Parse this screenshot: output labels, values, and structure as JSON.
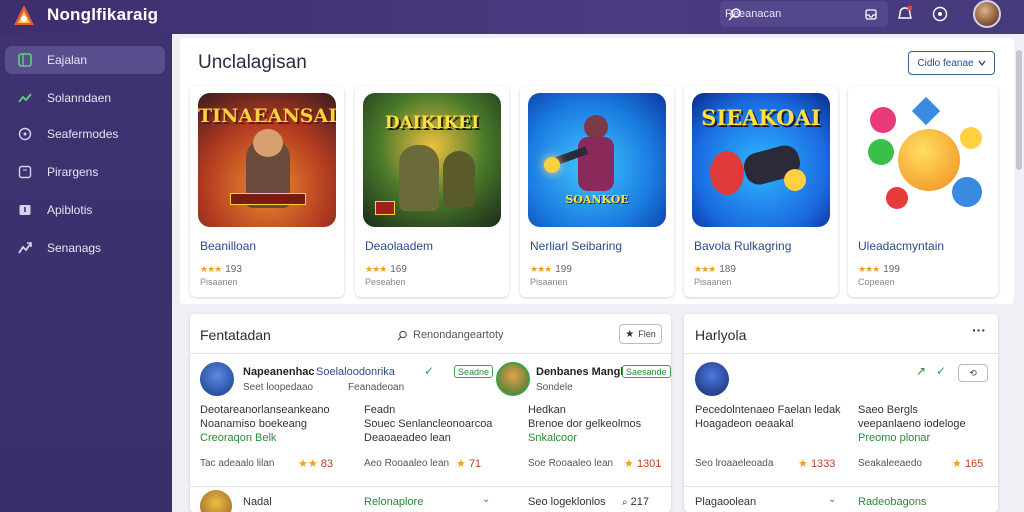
{
  "app": {
    "title": "Nonglfikaraig"
  },
  "search": {
    "placeholder": "Reeanacan"
  },
  "sidebar": {
    "items": [
      {
        "label": "Eajalan",
        "icon": "grid-icon",
        "active": true
      },
      {
        "label": "Solanndaen",
        "icon": "trend-icon",
        "active": false
      },
      {
        "label": "Seafermodes",
        "icon": "compass-icon",
        "active": false
      },
      {
        "label": "Pirargens",
        "icon": "square-icon",
        "active": false
      },
      {
        "label": "Apiblotis",
        "icon": "download-icon",
        "active": false
      },
      {
        "label": "Senanags",
        "icon": "share-icon",
        "active": false
      }
    ]
  },
  "featured": {
    "title": "Unclalagisan",
    "button": "Cidlo feanae",
    "cards": [
      {
        "art_title": "TINAEANSAI",
        "name": "Beanilloan",
        "stars": "★★★",
        "rating": "193",
        "sub": "Pisaanen"
      },
      {
        "art_title": "DAIKIKEI",
        "name": "Deaolaadem",
        "stars": "★★★",
        "rating": "169",
        "sub": "Peseahen"
      },
      {
        "art_title": "SOANKOE",
        "name": "Nerliarl Seibaring",
        "stars": "★★★",
        "rating": "199",
        "sub": "Pisaanen"
      },
      {
        "art_title": "SIEAKOAI",
        "name": "Bavola Rulkagring",
        "stars": "★★★",
        "rating": "189",
        "sub": "Pisaanen"
      },
      {
        "art_title": "",
        "name": "Uleadacmyntain",
        "stars": "★★★",
        "rating": "199",
        "sub": "Copeaen"
      }
    ]
  },
  "left_panel": {
    "title": "Fentatadan",
    "filter": "Renondangeartoty",
    "button": "Flen",
    "rows": [
      {
        "name": "Napeanenhac",
        "link": "Soelaloodonrika",
        "meta": "Seet loopedaao",
        "meta2": "Feanadeoan",
        "tag": "Seadne",
        "desc1": "Deotareanorlanseankeano",
        "desc2": "Noanamiso boekeang",
        "desc3": "Creoraqon Belk",
        "price_label": "Tac adeaalo lilan",
        "price": "83",
        "col2_1": "Feadn",
        "col2_2": "Souec Senlancleonoarcoa",
        "col2_3": "Deaoaeadeo lean",
        "col2_price_label": "Aeo Rooaaleo lean",
        "col2_price": "71"
      },
      {
        "name": "Denbanes Mangl",
        "meta": "Sondele",
        "tag": "Saesande",
        "desc1": "Hedkan",
        "desc2": "Brenoe dor gelkeolmos",
        "desc3": "Snkalcoor",
        "price_label": "Soe Rooaaleo lean",
        "price": "1301"
      }
    ],
    "bottom": {
      "name": "Nadal",
      "link": "Relonaplore",
      "right": "Seo logeklonlos",
      "count": "217"
    }
  },
  "right_panel": {
    "title": "Harlyola",
    "more": "···",
    "row": {
      "desc1": "Pecedolntenaeo Faelan ledak",
      "desc2": "Hoagadeon oeaakal",
      "col2_1": "Saeo Bergls",
      "col2_2": "veepanlaeno iodeloge",
      "col2_3": "Preomo plonar",
      "price_label": "Seo lroaaeleoada",
      "price": "1333",
      "col2_price_label": "Seakaleeaedo",
      "col2_price": "165"
    },
    "bottom": {
      "name": "Plagaoolean",
      "link": "Radeobagons"
    }
  }
}
